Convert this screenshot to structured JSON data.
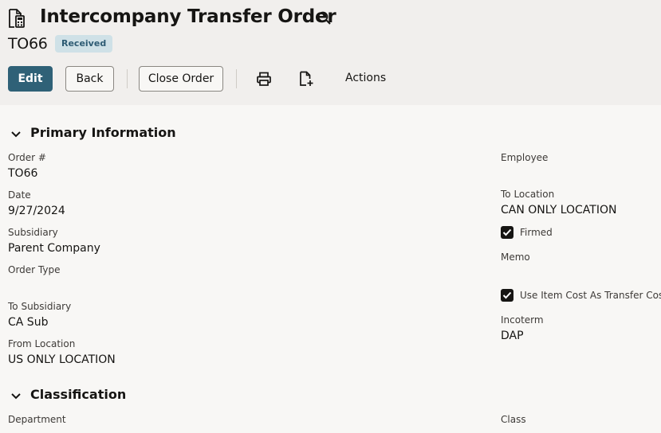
{
  "header": {
    "title": "Intercompany Transfer Order",
    "record_id": "TO66",
    "status": "Received",
    "doc_icon": "document-calculator-icon",
    "search_icon": "search-icon"
  },
  "toolbar": {
    "edit_label": "Edit",
    "back_label": "Back",
    "close_order_label": "Close Order",
    "print_icon": "print-icon",
    "new_document_icon": "new-document-icon",
    "actions_label": "Actions"
  },
  "primary": {
    "section_title": "Primary Information",
    "order_number": {
      "label": "Order #",
      "value": "TO66"
    },
    "date": {
      "label": "Date",
      "value": "9/27/2024"
    },
    "subsidiary": {
      "label": "Subsidiary",
      "value": "Parent Company"
    },
    "order_type": {
      "label": "Order Type",
      "value": ""
    },
    "to_subsidiary": {
      "label": "To Subsidiary",
      "value": "CA Sub"
    },
    "from_location": {
      "label": "From Location",
      "value": "US ONLY LOCATION"
    },
    "employee": {
      "label": "Employee",
      "value": ""
    },
    "to_location": {
      "label": "To Location",
      "value": "CAN ONLY LOCATION"
    },
    "firmed": {
      "label": "Firmed",
      "checked": true
    },
    "memo": {
      "label": "Memo",
      "value": ""
    },
    "use_item_cost": {
      "label": "Use Item Cost As Transfer Cost",
      "checked": true
    },
    "incoterm": {
      "label": "Incoterm",
      "value": "DAP"
    }
  },
  "classification": {
    "section_title": "Classification",
    "department": {
      "label": "Department"
    },
    "class": {
      "label": "Class"
    }
  },
  "colors": {
    "primary_button": "#2f6177",
    "badge_bg": "#cfe1e7",
    "badge_text": "#2d5b73",
    "header_bg": "#f1efed",
    "page_bg": "#f8f7f5"
  }
}
